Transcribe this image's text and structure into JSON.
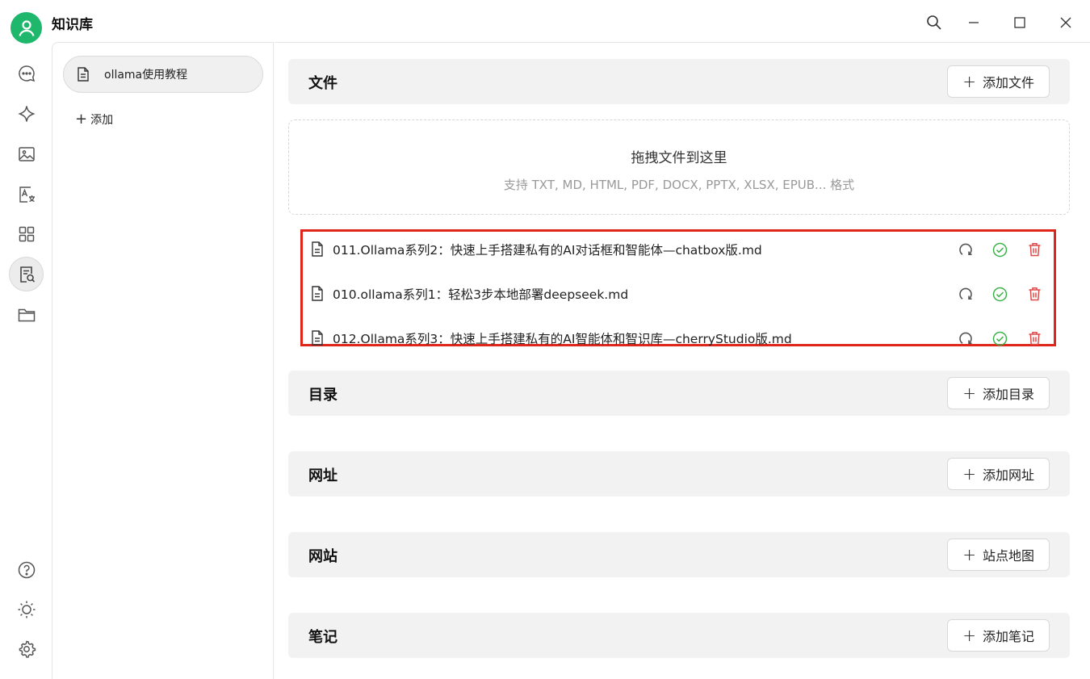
{
  "window": {
    "title": "知识库"
  },
  "rail": {
    "items": [
      {
        "icon": "chat-bubble-icon"
      },
      {
        "icon": "sparkle-icon"
      },
      {
        "icon": "image-icon"
      },
      {
        "icon": "translate-icon"
      },
      {
        "icon": "apps-grid-icon"
      },
      {
        "icon": "knowledge-base-icon",
        "active": true
      },
      {
        "icon": "folder-icon"
      }
    ],
    "bottom": [
      {
        "icon": "help-icon"
      },
      {
        "icon": "theme-sun-icon"
      },
      {
        "icon": "settings-icon"
      }
    ]
  },
  "sidebar": {
    "knowledge_bases": [
      {
        "label": "ollama使用教程"
      }
    ],
    "add_label": "添加"
  },
  "sections": {
    "files": {
      "title": "文件",
      "button": "添加文件"
    },
    "dropzone": {
      "title": "拖拽文件到这里",
      "hint": "支持 TXT, MD, HTML, PDF, DOCX, PPTX, XLSX, EPUB... 格式"
    },
    "file_list": [
      {
        "name": "011.Ollama系列2：快速上手搭建私有的AI对话框和智能体—chatbox版.md"
      },
      {
        "name": "010.ollama系列1：轻松3步本地部署deepseek.md"
      },
      {
        "name": "012.Ollama系列3：快速上手搭建私有的AI智能体和智识库—cherryStudio版.md"
      }
    ],
    "directory": {
      "title": "目录",
      "button": "添加目录"
    },
    "url": {
      "title": "网址",
      "button": "添加网址"
    },
    "website": {
      "title": "网站",
      "button": "站点地图"
    },
    "notes": {
      "title": "笔记",
      "button": "添加笔记"
    }
  },
  "colors": {
    "accent_green": "#1fb76c",
    "success_green": "#3bb24a",
    "delete_red": "#e04848",
    "highlight_border": "#e0251b"
  }
}
